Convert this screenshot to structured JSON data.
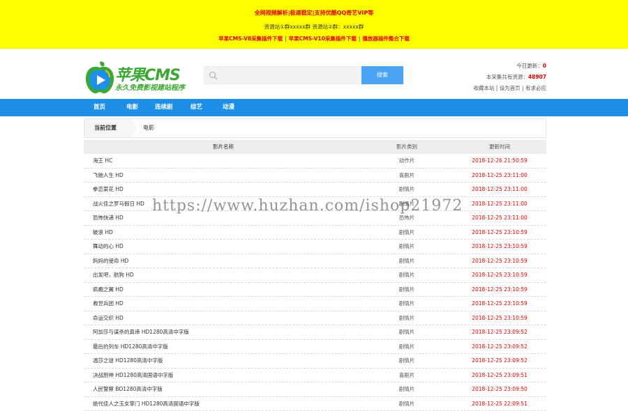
{
  "topbar": {
    "line1": "全网视频解析|极速稳定|支持优酷QQ奇艺VIP等",
    "line2": "资源站①群xxxxx群 资源站②群：xxxxx群",
    "links": [
      "苹果CMS-V8采集插件下载",
      "苹果CMS-V10采集插件下载",
      "播放器插件整合下载"
    ],
    "separator": "|"
  },
  "logo": {
    "title": "苹果CMS",
    "slogan": "永久免费影视建站程序"
  },
  "search": {
    "placeholder": "",
    "button": "搜索"
  },
  "stats": {
    "today_label": "今日更新：",
    "today_value": "0",
    "total_label": "本采集共有资源：",
    "total_value": "48907",
    "links": [
      "收藏本站",
      "设为首页",
      "有求必应"
    ],
    "separator": "|"
  },
  "nav": [
    "首页",
    "电影",
    "连续剧",
    "综艺",
    "动漫"
  ],
  "breadcrumb": {
    "current_label": "当前位置",
    "category": "电影"
  },
  "table": {
    "headers": [
      "影片名称",
      "影片类别",
      "更新时间"
    ],
    "rows": [
      {
        "name": "海王 HC",
        "type": "动作片",
        "time": "2018-12-26 21:50:59"
      },
      {
        "name": "飞驰人生 HD",
        "type": "喜剧片",
        "time": "2018-12-25 23:11:00"
      },
      {
        "name": "拳恋菜花 HD",
        "type": "剧情片",
        "time": "2018-12-25 23:11:00"
      },
      {
        "name": "战火佳之罗马假日 HD",
        "type": "剧情片",
        "time": "2018-12-25 23:11:00"
      },
      {
        "name": "恐怖快递 HD",
        "type": "恐怖片",
        "time": "2018-12-25 23:11:00"
      },
      {
        "name": "破浪 HD",
        "type": "剧情片",
        "time": "2018-12-25 23:10:59"
      },
      {
        "name": "舞动的心 HD",
        "type": "剧情片",
        "time": "2018-12-25 23:10:59"
      },
      {
        "name": "妈妈的使命 HD",
        "type": "剧情片",
        "time": "2018-12-25 23:10:59"
      },
      {
        "name": "出发吧，航狗 HD",
        "type": "剧情片",
        "time": "2018-12-25 23:10:59"
      },
      {
        "name": "疯癫之翼 HD",
        "type": "剧情片",
        "time": "2018-12-25 23:10:59"
      },
      {
        "name": "救世兵团 HD",
        "type": "剧情片",
        "time": "2018-12-25 23:10:59"
      },
      {
        "name": "命运交织 HD",
        "type": "剧情片",
        "time": "2018-12-25 23:10:59"
      },
      {
        "name": "阿加莎与谋杀的真谛 HD1280高清中字版",
        "type": "剧情片",
        "time": "2018-12-25 23:09:52"
      },
      {
        "name": "最后的列车 HD1280高清中字版",
        "type": "剧情片",
        "time": "2018-12-25 23:09:52"
      },
      {
        "name": "温莎之谜 HD1280高清中字版",
        "type": "剧情片",
        "time": "2018-12-25 23:09:52"
      },
      {
        "name": "决战厨神 HD1280高清国语中字版",
        "type": "喜剧片",
        "time": "2018-12-25 23:09:51"
      },
      {
        "name": "人民警察 BD1280高清中字版",
        "type": "剧情片",
        "time": "2018-12-25 23:09:50"
      },
      {
        "name": "绝代佳人之玉女掌门 HD1280高清国语中字版",
        "type": "剧情片",
        "time": "2018-12-25 22:09:51"
      }
    ]
  },
  "watermark": "https://www.huzhan.com/ishop21972",
  "colors": {
    "topbar_bg": "#ffff00",
    "nav_bg": "#1e8fe8",
    "search_button": "#4aa3f4",
    "accent_red": "#e60000",
    "logo_green": "#3aa832"
  }
}
